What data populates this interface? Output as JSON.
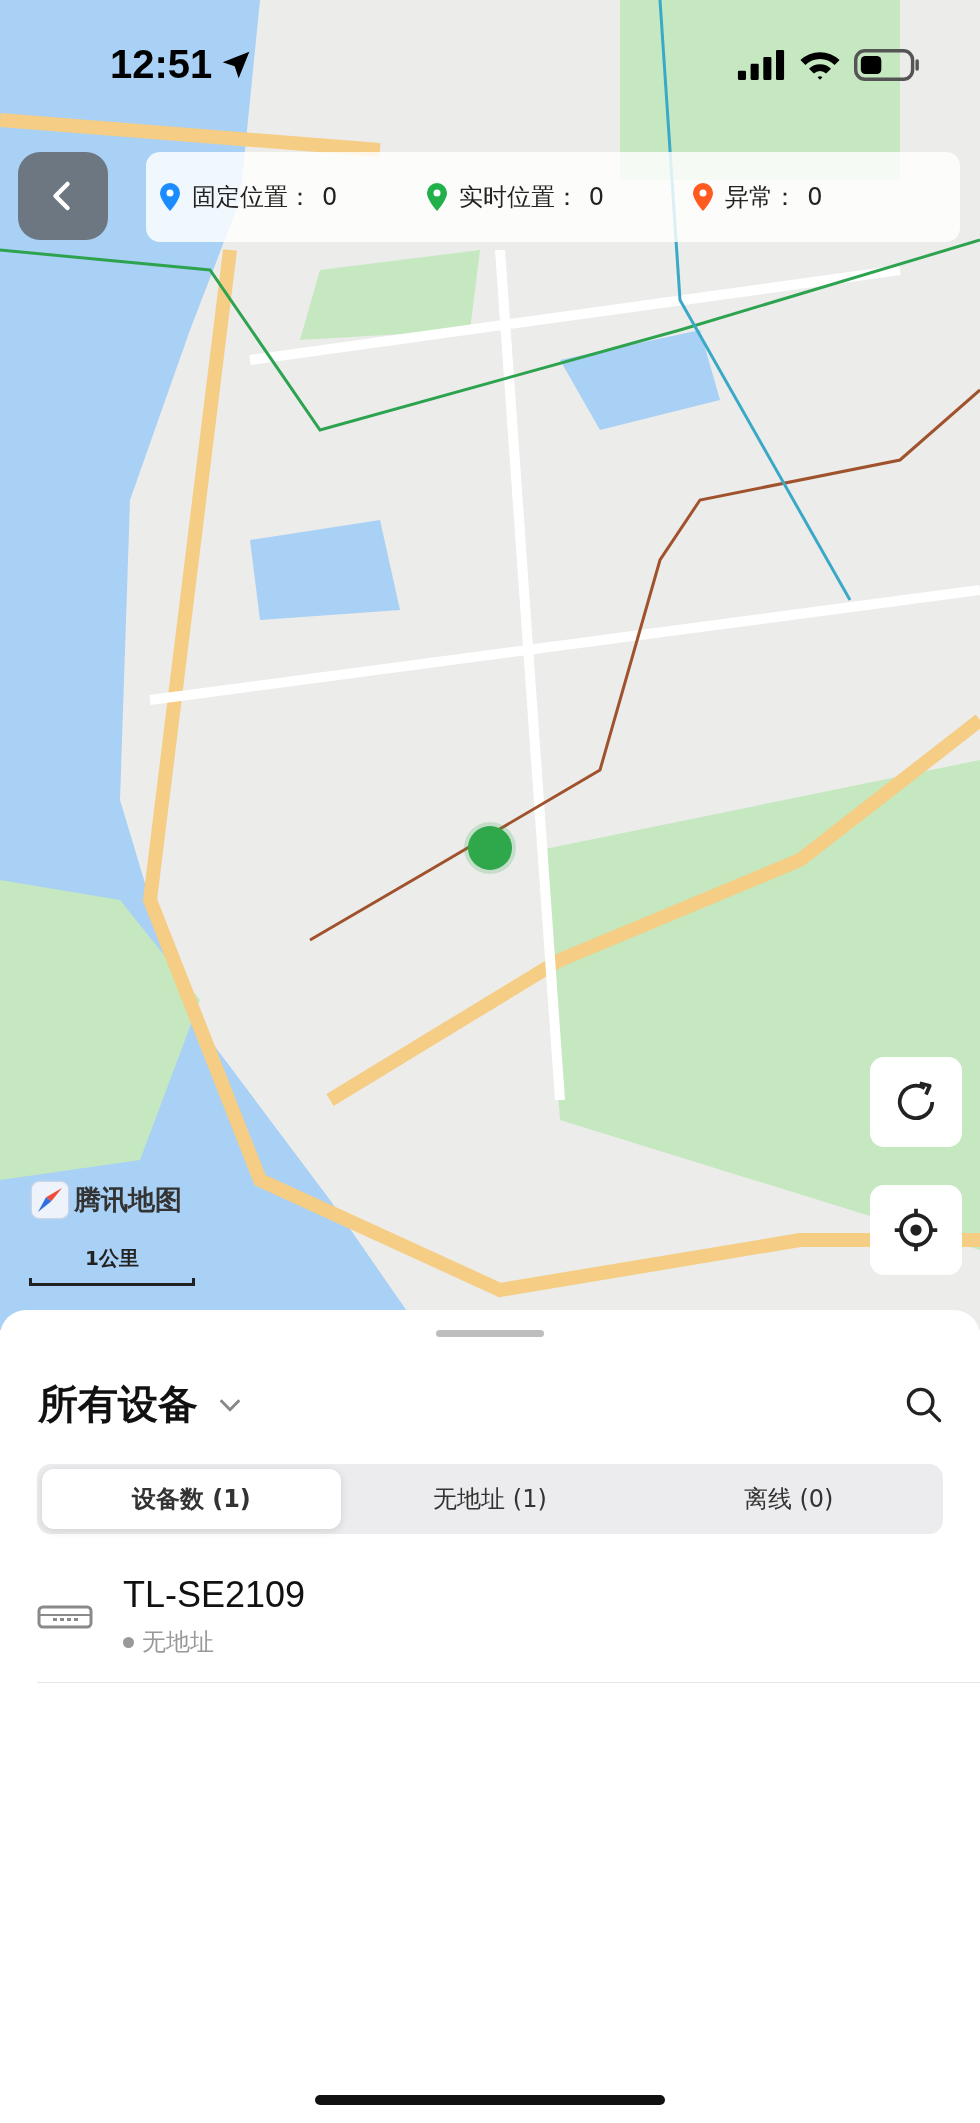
{
  "status_bar": {
    "time": "12:51"
  },
  "legend": [
    {
      "label": "固定位置：",
      "count": "0",
      "color": "#1a8cff"
    },
    {
      "label": "实时位置：",
      "count": "0",
      "color": "#22b04b"
    },
    {
      "label": "异常：",
      "count": "0",
      "color": "#ff5a1f"
    }
  ],
  "map": {
    "attribution": "腾讯地图",
    "scale": "1公里"
  },
  "sheet": {
    "title": "所有设备",
    "tabs": [
      {
        "label": "设备数 (1)",
        "selected": true
      },
      {
        "label": "无地址 (1)",
        "selected": false
      },
      {
        "label": "离线 (0)",
        "selected": false
      }
    ],
    "devices": [
      {
        "name": "TL-SE2109",
        "status": "无地址"
      }
    ]
  }
}
